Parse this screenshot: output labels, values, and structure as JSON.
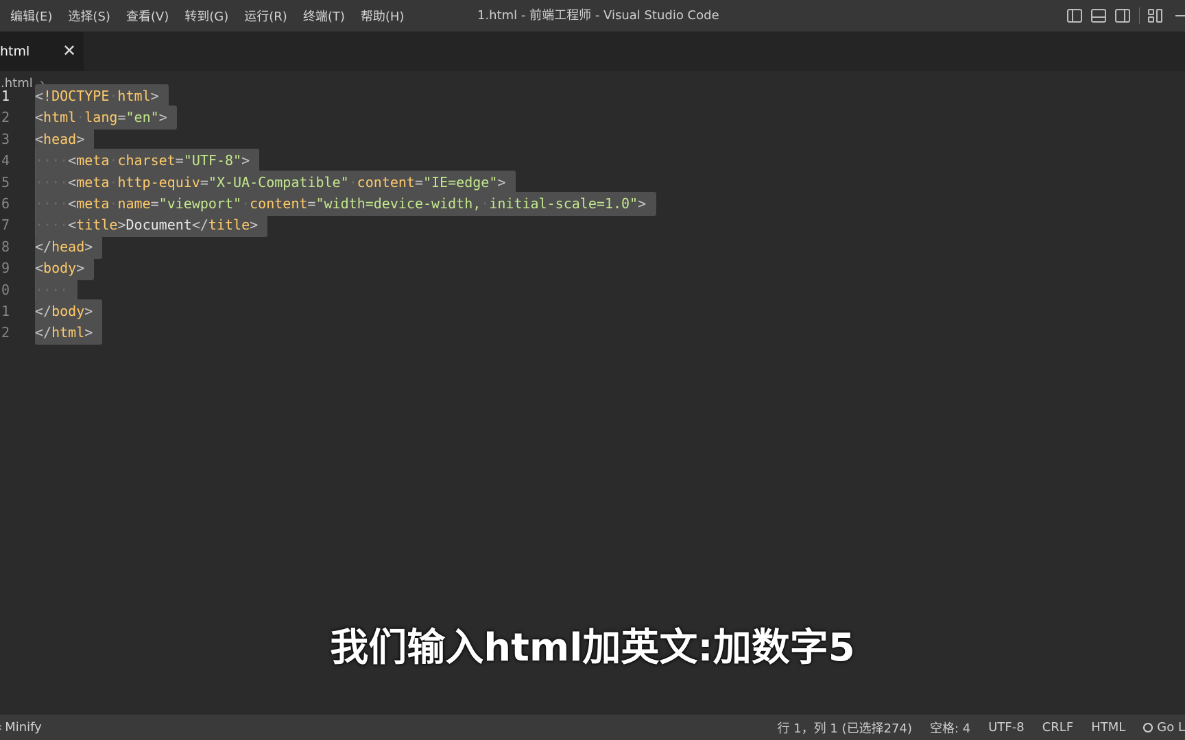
{
  "menu": [
    "编辑(E)",
    "选择(S)",
    "查看(V)",
    "转到(G)",
    "运行(R)",
    "终端(T)",
    "帮助(H)"
  ],
  "window_title": "1.html - 前端工程师 - Visual Studio Code",
  "tab": {
    "label": "html",
    "close": "✕"
  },
  "breadcrumb": {
    "file": "l.html",
    "sep": "›",
    "rest": "..."
  },
  "line_numbers": [
    "1",
    "2",
    "3",
    "4",
    "5",
    "6",
    "7",
    "8",
    "9",
    "0",
    "1",
    "2"
  ],
  "code_lines": [
    [
      [
        "t-br",
        "<"
      ],
      [
        "t-doc",
        "!DOCTYPE"
      ],
      [
        "t-ws",
        "·"
      ],
      [
        "t-doc",
        "html"
      ],
      [
        "t-br",
        ">"
      ]
    ],
    [
      [
        "t-br",
        "<"
      ],
      [
        "t-tag",
        "html"
      ],
      [
        "t-ws",
        "·"
      ],
      [
        "t-attr",
        "lang"
      ],
      [
        "t-eq",
        "="
      ],
      [
        "t-str",
        "\"en\""
      ],
      [
        "t-br",
        ">"
      ]
    ],
    [
      [
        "t-br",
        "<"
      ],
      [
        "t-tag",
        "head"
      ],
      [
        "t-br",
        ">"
      ]
    ],
    [
      [
        "t-ws",
        "····"
      ],
      [
        "t-br",
        "<"
      ],
      [
        "t-tag",
        "meta"
      ],
      [
        "t-ws",
        "·"
      ],
      [
        "t-attr",
        "charset"
      ],
      [
        "t-eq",
        "="
      ],
      [
        "t-str",
        "\"UTF-8\""
      ],
      [
        "t-br",
        ">"
      ]
    ],
    [
      [
        "t-ws",
        "····"
      ],
      [
        "t-br",
        "<"
      ],
      [
        "t-tag",
        "meta"
      ],
      [
        "t-ws",
        "·"
      ],
      [
        "t-attr",
        "http-equiv"
      ],
      [
        "t-eq",
        "="
      ],
      [
        "t-str",
        "\"X-UA-Compatible\""
      ],
      [
        "t-ws",
        "·"
      ],
      [
        "t-attr",
        "content"
      ],
      [
        "t-eq",
        "="
      ],
      [
        "t-str",
        "\"IE=edge\""
      ],
      [
        "t-br",
        ">"
      ]
    ],
    [
      [
        "t-ws",
        "····"
      ],
      [
        "t-br",
        "<"
      ],
      [
        "t-tag",
        "meta"
      ],
      [
        "t-ws",
        "·"
      ],
      [
        "t-attr",
        "name"
      ],
      [
        "t-eq",
        "="
      ],
      [
        "t-str",
        "\"viewport\""
      ],
      [
        "t-ws",
        "·"
      ],
      [
        "t-attr",
        "content"
      ],
      [
        "t-eq",
        "="
      ],
      [
        "t-str",
        "\"width=device-width,"
      ],
      [
        "t-ws",
        "·"
      ],
      [
        "t-str",
        "initial-scale=1.0\""
      ],
      [
        "t-br",
        ">"
      ]
    ],
    [
      [
        "t-ws",
        "····"
      ],
      [
        "t-br",
        "<"
      ],
      [
        "t-tag",
        "title"
      ],
      [
        "t-br",
        ">"
      ],
      [
        "t-txt",
        "Document"
      ],
      [
        "t-br",
        "</"
      ],
      [
        "t-tag",
        "title"
      ],
      [
        "t-br",
        ">"
      ]
    ],
    [
      [
        "t-br",
        "</"
      ],
      [
        "t-tag",
        "head"
      ],
      [
        "t-br",
        ">"
      ]
    ],
    [
      [
        "t-br",
        "<"
      ],
      [
        "t-tag",
        "body"
      ],
      [
        "t-br",
        ">"
      ]
    ],
    [
      [
        "t-ws",
        "····"
      ]
    ],
    [
      [
        "t-br",
        "</"
      ],
      [
        "t-tag",
        "body"
      ],
      [
        "t-br",
        ">"
      ]
    ],
    [
      [
        "t-br",
        "</"
      ],
      [
        "t-tag",
        "html"
      ],
      [
        "t-br",
        ">"
      ]
    ]
  ],
  "subtitle": "我们输入html加英文:加数字5",
  "status_left": "Minify",
  "status_right": [
    "行 1，列 1 (已选择274)",
    "空格: 4",
    "UTF-8",
    "CRLF",
    "HTML",
    "Go L"
  ],
  "colors": {
    "tag": "#ffcb6b",
    "string": "#c3e88d",
    "selection": "#4f4f4f",
    "editor_bg": "#2b2b2b"
  }
}
